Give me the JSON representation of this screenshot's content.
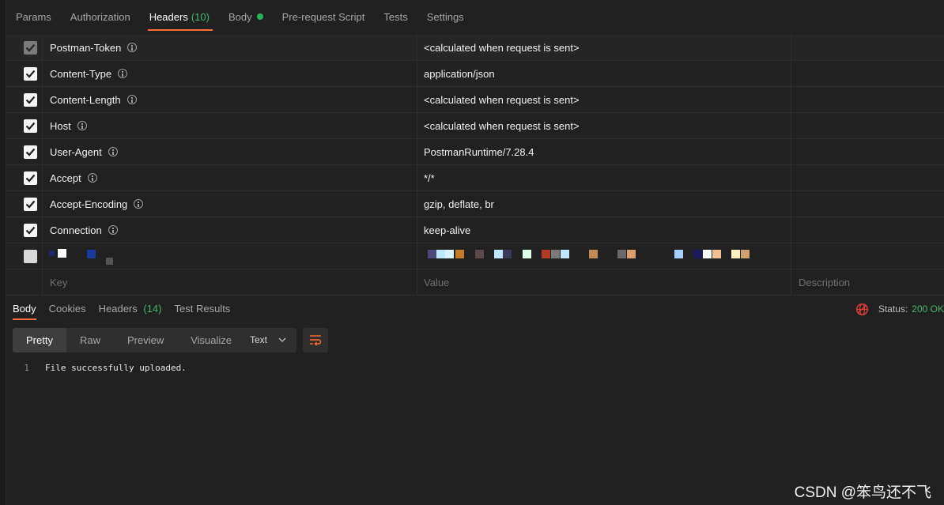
{
  "request_tabs": [
    {
      "label": "Params"
    },
    {
      "label": "Authorization"
    },
    {
      "label": "Headers",
      "count": "(10)"
    },
    {
      "label": "Body"
    },
    {
      "label": "Pre-request Script"
    },
    {
      "label": "Tests"
    },
    {
      "label": "Settings"
    }
  ],
  "active_request_tab": "Headers",
  "headers": [
    {
      "key": "Postman-Token",
      "value": "<calculated when request is sent>",
      "checked": true,
      "disabled": true
    },
    {
      "key": "Content-Type",
      "value": "application/json",
      "checked": true
    },
    {
      "key": "Content-Length",
      "value": "<calculated when request is sent>",
      "checked": true
    },
    {
      "key": "Host",
      "value": "<calculated when request is sent>",
      "checked": true
    },
    {
      "key": "User-Agent",
      "value": "PostmanRuntime/7.28.4",
      "checked": true
    },
    {
      "key": "Accept",
      "value": "*/*",
      "checked": true
    },
    {
      "key": "Accept-Encoding",
      "value": "gzip, deflate, br",
      "checked": true
    },
    {
      "key": "Connection",
      "value": "keep-alive",
      "checked": true
    }
  ],
  "placeholder_row": {
    "key": "Key",
    "value": "Value",
    "description": "Description"
  },
  "response_tabs": [
    {
      "label": "Body"
    },
    {
      "label": "Cookies"
    },
    {
      "label": "Headers",
      "count": "(14)"
    },
    {
      "label": "Test Results"
    }
  ],
  "status": {
    "label": "Status:",
    "code": "200 OK"
  },
  "view_modes": [
    "Pretty",
    "Raw",
    "Preview",
    "Visualize"
  ],
  "active_view_mode": "Pretty",
  "format_select": "Text",
  "response_body": [
    {
      "line": "1",
      "text": "File successfully uploaded."
    }
  ],
  "watermark": "CSDN @笨鸟还不飞",
  "colors": {
    "accent": "#ff6c37",
    "count_green": "#49b36a",
    "body_dot": "#26b55a",
    "background": "#212121"
  },
  "icons": [
    "info-icon",
    "check-icon",
    "globe-icon",
    "chevron-down-icon",
    "wrap-lines-icon"
  ]
}
